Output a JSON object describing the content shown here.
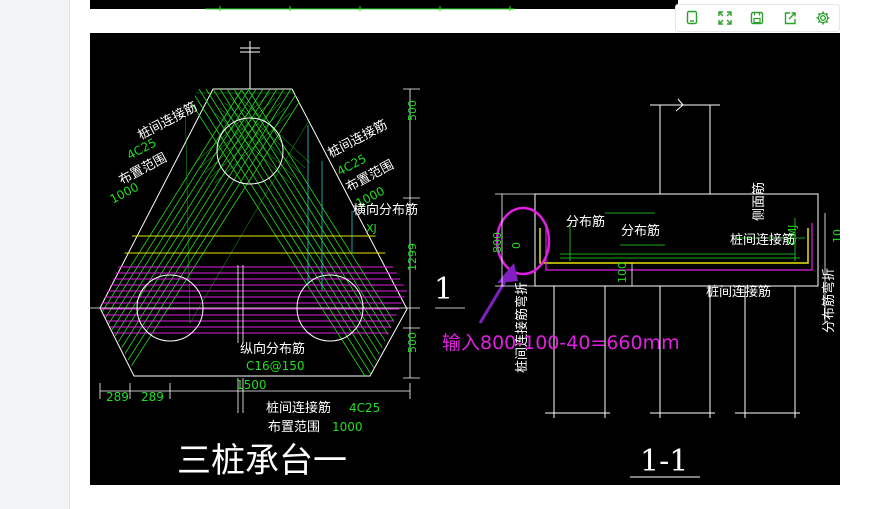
{
  "toolbar": {
    "buttons": [
      {
        "icon": "copy-icon"
      },
      {
        "icon": "fullscreen-icon"
      },
      {
        "icon": "save-icon"
      },
      {
        "icon": "share-icon"
      },
      {
        "icon": "gear-icon"
      }
    ],
    "accent_color": "#2ca02c"
  },
  "drawing": {
    "colors": {
      "background": "#000000",
      "outline": "#ffffff",
      "rebar": "#22dd22",
      "yellow": "#e5e500",
      "magenta": "#e020e0",
      "cyan": "#20d0d0"
    },
    "plan": {
      "left_rebar_label": "桩间连接筋",
      "left_rebar_spec": "4C25",
      "left_range_label": "布置范围",
      "left_range_value": "1000",
      "right_rebar_label": "桩间连接筋",
      "right_rebar_spec": "4C25",
      "right_range_label": "布置范围",
      "right_range_value": "1000",
      "transverse_label": "横向分布筋",
      "transverse_tag": "XJ",
      "longitudinal_label": "纵向分布筋",
      "longitudinal_spec": "C16@150",
      "bottom_rebar_label": "桩间连接筋",
      "bottom_rebar_spec": "4C25",
      "bottom_range_label": "布置范围",
      "bottom_range_value": "1000",
      "dim_top": "500",
      "dim_mid": "1299",
      "dim_bottom": "500",
      "dim_width": "1500",
      "dim_left_a": "289",
      "dim_left_b": "289",
      "title": "三桩承台一",
      "section_mark": "1"
    },
    "section": {
      "distribution_label_1": "分布筋",
      "distribution_label_2": "分布筋",
      "side_rebar_label": "侧面筋",
      "side_rebar_tag": "CMJ",
      "connect_label_1": "桩间连接筋",
      "connect_label_2": "桩间连接筋",
      "dim_800": "800",
      "dim_zero": "0",
      "dim_100": "100",
      "left_bend_label": "桩间连接筋弯折",
      "right_bend_label": "分布筋弯折",
      "right_dim_fragment": "10",
      "title": "1-1"
    },
    "annotation": {
      "text": "输入800-100-40=660mm",
      "color": "#e020e0"
    }
  }
}
